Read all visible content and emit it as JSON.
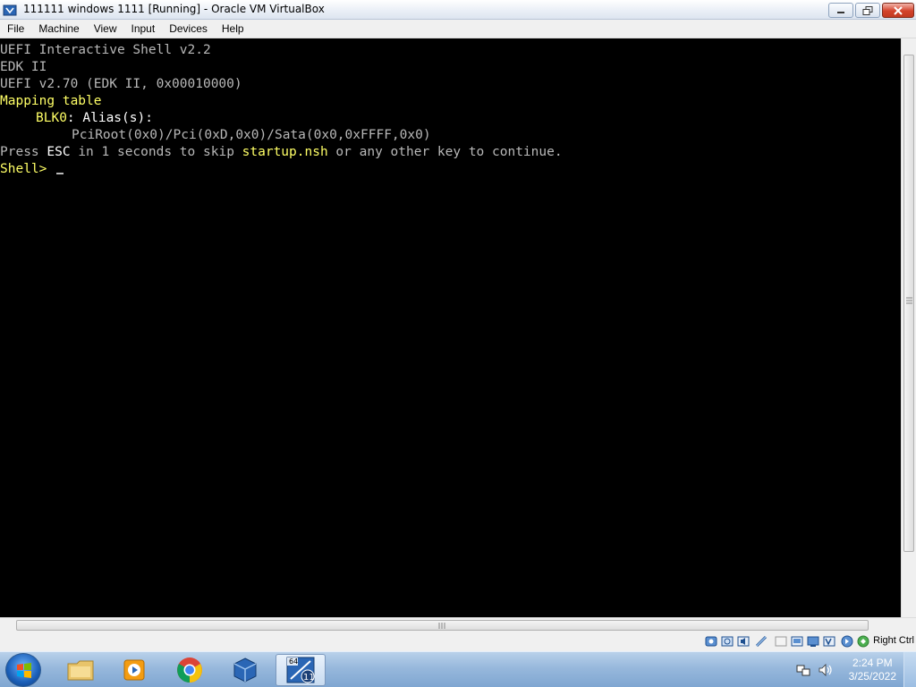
{
  "window": {
    "title": "111111 windows 1111 [Running] - Oracle VM VirtualBox"
  },
  "menu": {
    "items": [
      "File",
      "Machine",
      "View",
      "Input",
      "Devices",
      "Help"
    ]
  },
  "console": {
    "line1": "UEFI Interactive Shell v2.2",
    "line2": "EDK II",
    "line3": "UEFI v2.70 (EDK II, 0x00010000)",
    "line4": "Mapping table",
    "blk_label": "BLK0",
    "alias_text": ": Alias(s):",
    "device_path": "PciRoot(0x0)/Pci(0xD,0x0)/Sata(0x0,0xFFFF,0x0)",
    "press_prefix": "Press ",
    "esc_key": "ESC",
    "press_middle": " in 1 seconds to skip ",
    "startup_file": "startup.nsh",
    "press_suffix": " or any other key to continue.",
    "prompt": "Shell>"
  },
  "statusbar": {
    "host_key": "Right Ctrl"
  },
  "taskbar": {
    "time": "2:24 PM",
    "date": "3/25/2022",
    "badge_64": "64",
    "badge_11": "11"
  },
  "colors": {
    "console_bg": "#000000",
    "console_text": "#b8b8b8",
    "console_highlight": "#ffff66",
    "taskbar": "#97b8dc"
  }
}
